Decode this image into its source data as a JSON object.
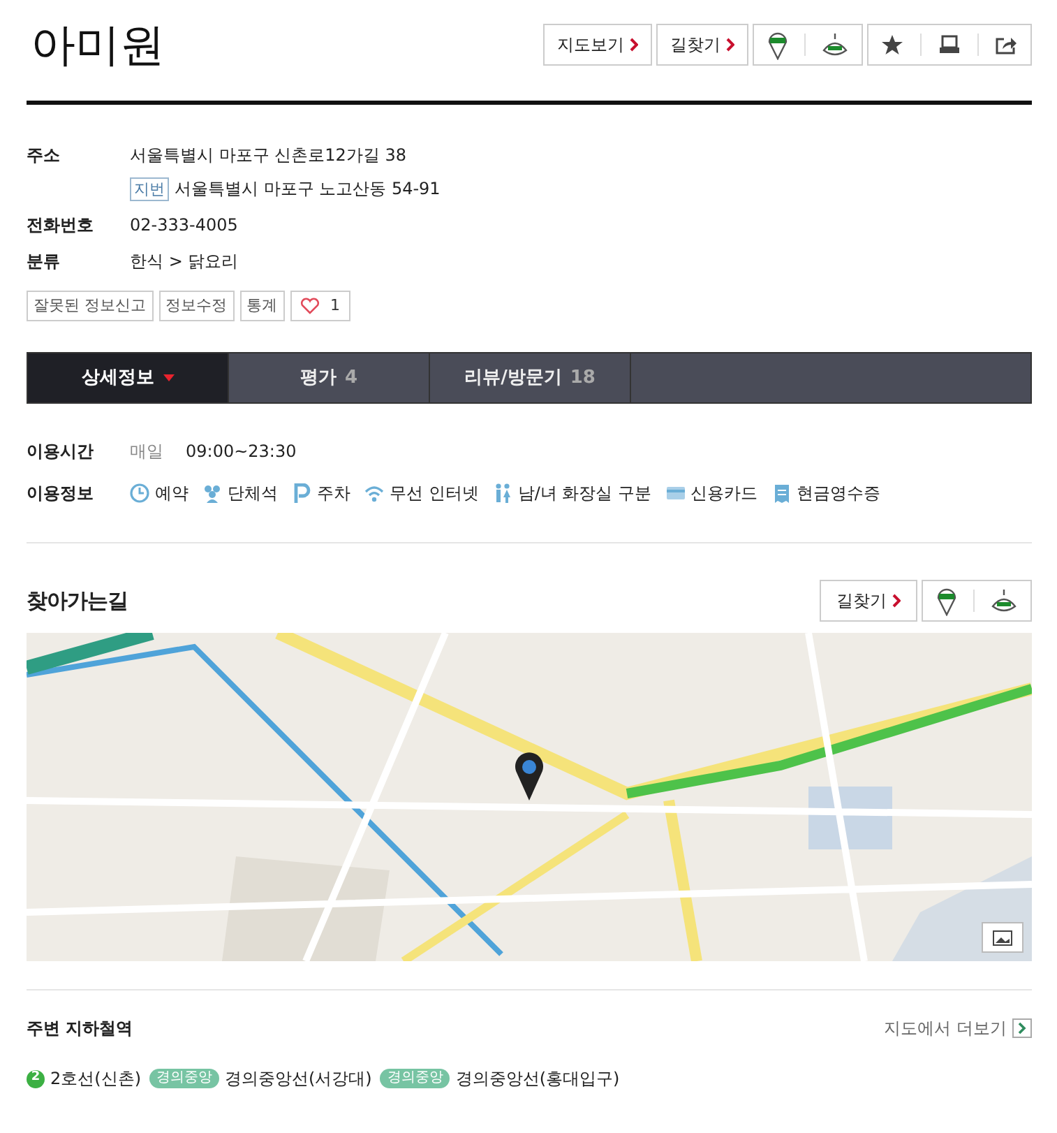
{
  "title": "아미원",
  "header_buttons": [
    "지도보기",
    "길찾기"
  ],
  "info": [
    {
      "label": "주소",
      "lines": [
        {
          "text": "서울특별시 마포구 신촌로12가길 38"
        },
        {
          "tag": "지번",
          "text": "서울특별시 마포구 노고산동 54-91"
        }
      ]
    },
    {
      "label": "전화번호",
      "lines": [
        {
          "text": "02-333-4005"
        }
      ]
    },
    {
      "label": "분류",
      "lines": [
        {
          "text": "한식 > 닭요리"
        }
      ]
    }
  ],
  "actions": [
    "잘못된 정보신고",
    "정보수정",
    "통계"
  ],
  "like_count": "1",
  "tabs": [
    {
      "label": "상세정보",
      "selected": true
    },
    {
      "label": "평가",
      "count": "4",
      "selected": false
    },
    {
      "label": "리뷰/방문기",
      "count": "18",
      "selected": false
    }
  ],
  "hours": {
    "label": "이용시간",
    "days": "매일",
    "time": "09:00~23:30"
  },
  "amenities": {
    "label": "이용정보",
    "items": [
      {
        "kind": "clock",
        "text": "예약"
      },
      {
        "kind": "group",
        "text": "단체석"
      },
      {
        "kind": "parking",
        "text": "주차"
      },
      {
        "kind": "wifi",
        "text": "무선 인터넷"
      },
      {
        "kind": "restroom",
        "text": "남/녀 화장실 구분"
      },
      {
        "kind": "card",
        "text": "신용카드"
      },
      {
        "kind": "receipt",
        "text": "현금영수증"
      }
    ]
  },
  "directions": {
    "title": "찾아가는길",
    "button": "길찾기"
  },
  "subway": {
    "title": "주변 지하철역",
    "more": "지도에서 더보기",
    "stations": [
      {
        "badge": "2",
        "kind": "circle",
        "color": "#3cb043",
        "name": "2호선(신촌)"
      },
      {
        "badge": "경의중앙",
        "kind": "pill",
        "color": "#77c4a3",
        "name": "경의중앙선(서강대)"
      },
      {
        "badge": "경의중앙",
        "kind": "pill",
        "color": "#77c4a3",
        "name": "경의중앙선(홍대입구)"
      }
    ]
  }
}
